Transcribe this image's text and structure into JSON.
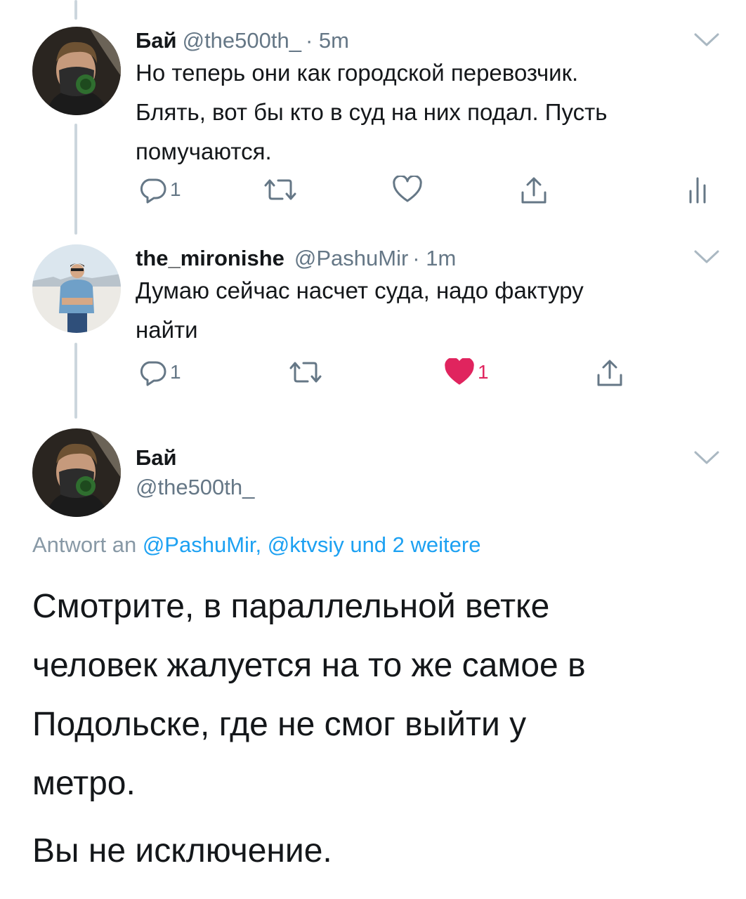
{
  "tweets": [
    {
      "name": "Бай",
      "handle": "@the500th_",
      "time": "· 5m",
      "text_lines": [
        "Но теперь они как городской перевозчик.",
        "Блять, вот бы кто в суд на них подал. Пусть",
        "помучаются."
      ],
      "reply_count": "1",
      "like_count": ""
    },
    {
      "name": "the_mironishe",
      "handle": "@PashuMir",
      "time": "· 1m",
      "text_lines": [
        "Думаю сейчас насчет суда, надо фактуру",
        "найти"
      ],
      "reply_count": "1",
      "like_count": "1"
    }
  ],
  "focused": {
    "name": "Бай",
    "handle": "@the500th_",
    "reply_prefix": "Antwort an",
    "reply_to": "@PashuMir, @ktvsiy und 2 weitere",
    "text_lines": [
      "Смотрите, в параллельной ветке",
      "человек жалуется на то же самое в",
      "Подольске, где не смог выйти у",
      "метро."
    ],
    "text_line_last": "Вы не исключение."
  },
  "icons": [
    "reply-icon",
    "retweet-icon",
    "like-icon",
    "share-icon",
    "analytics-icon",
    "chevron-down-icon"
  ],
  "colors": {
    "text": "#14171a",
    "muted": "#657786",
    "link": "#1da1f2",
    "like": "#e0245e",
    "thread": "#ccd6dd"
  }
}
